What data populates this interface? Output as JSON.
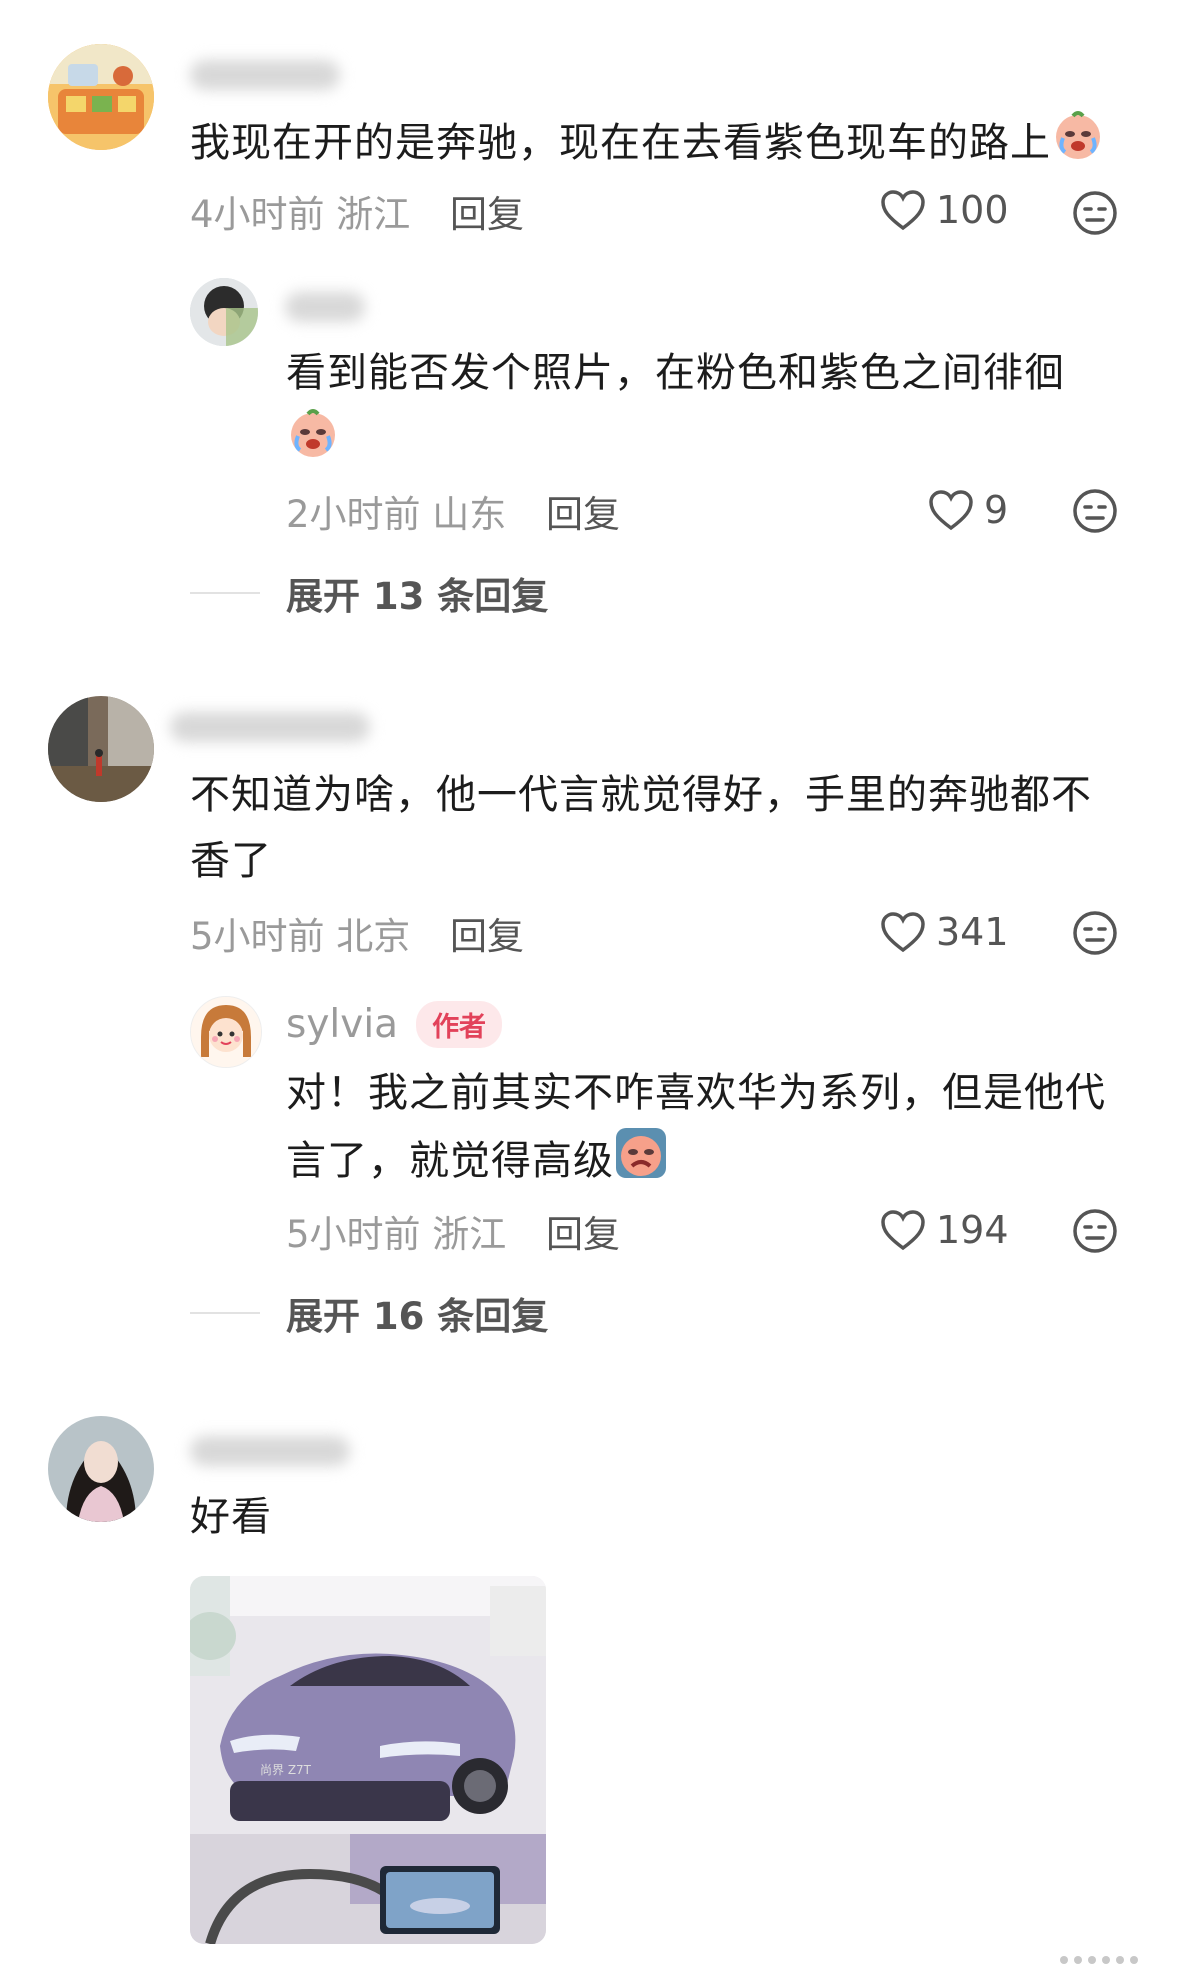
{
  "comments": [
    {
      "text": "我现在开的是奔驰，现在在去看紫色现车的路上",
      "time_location": "4小时前 浙江",
      "reply_label": "回复",
      "likes": "100",
      "replies": [
        {
          "text": "看到能否发个照片，在粉色和紫色之间徘徊",
          "time_location": "2小时前 山东",
          "reply_label": "回复",
          "likes": "9"
        }
      ],
      "expand_label": "展开 13 条回复"
    },
    {
      "text": "不知道为啥，他一代言就觉得好，手里的奔驰都不香了",
      "time_location": "5小时前 北京",
      "reply_label": "回复",
      "likes": "341",
      "replies": [
        {
          "username": "sylvia",
          "badge": "作者",
          "text": "对！我之前其实不咋喜欢华为系列，但是他代言了，就觉得高级",
          "time_location": "5小时前 浙江",
          "reply_label": "回复",
          "likes": "194"
        }
      ],
      "expand_label": "展开 16 条回复"
    },
    {
      "text": "好看",
      "image_caption": "尚界 Z7T"
    }
  ],
  "colors": {
    "accent_author": "#e2425a",
    "meta_gray": "#9a9a9a",
    "car_purple": "#8f86b3"
  }
}
